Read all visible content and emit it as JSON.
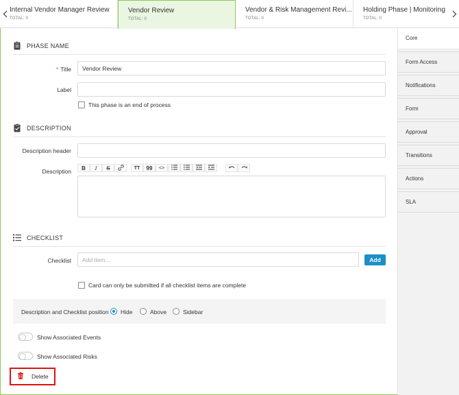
{
  "tabs": [
    {
      "title": "Internal Vendor Manager Review",
      "total": "TOTAL: 0"
    },
    {
      "title": "Vendor Review",
      "total": "TOTAL: 0"
    },
    {
      "title": "Vendor & Risk Management Revi...",
      "total": "TOTAL: 0"
    },
    {
      "title": "Holding Phase | Monitoring",
      "total": "TOTAL: 0"
    }
  ],
  "active_tab": "Vendor Review",
  "sections": {
    "phase_name": "PHASE NAME",
    "description": "DESCRIPTION",
    "checklist": "CHECKLIST"
  },
  "form": {
    "title_label": "Title",
    "title_required": "*",
    "title_value": "Vendor Review",
    "label_label": "Label",
    "label_value": "",
    "end_of_process": "This phase is an end of process",
    "description_header_label": "Description header",
    "description_label": "Description",
    "checklist_label": "Checklist",
    "checklist_placeholder": "Add item...",
    "add_label": "Add",
    "checklist_complete": "Card can only be submitted if all checklist items are complete",
    "position_label": "Description and Checklist position",
    "position_options": [
      "Hide",
      "Above",
      "Sidebar"
    ],
    "position_selected": "Hide",
    "show_events": "Show Associated Events",
    "show_risks": "Show Associated Risks",
    "delete_label": "Delete"
  },
  "toolbar": {
    "bold": "B",
    "italic": "I",
    "strike": "S",
    "link": "link-icon",
    "text_size": "TT",
    "quote": "99",
    "code": "<>",
    "bullets": "bullet-list-icon",
    "numbers": "numbered-list-icon",
    "outdent": "outdent-icon",
    "indent": "indent-icon",
    "undo": "undo-icon",
    "redo": "redo-icon"
  },
  "sidebar": [
    {
      "label": "Core"
    },
    {
      "label": "Form Access"
    },
    {
      "label": "Notifications"
    },
    {
      "label": "Form"
    },
    {
      "label": "Approval"
    },
    {
      "label": "Transitions"
    },
    {
      "label": "Actions"
    },
    {
      "label": "SLA"
    }
  ],
  "colors": {
    "active_tab_bg": "#eaf6e2",
    "active_tab_border": "#8cc85a",
    "primary": "#1d8ec7",
    "delete_highlight": "#e01010",
    "required": "#d9534f"
  }
}
